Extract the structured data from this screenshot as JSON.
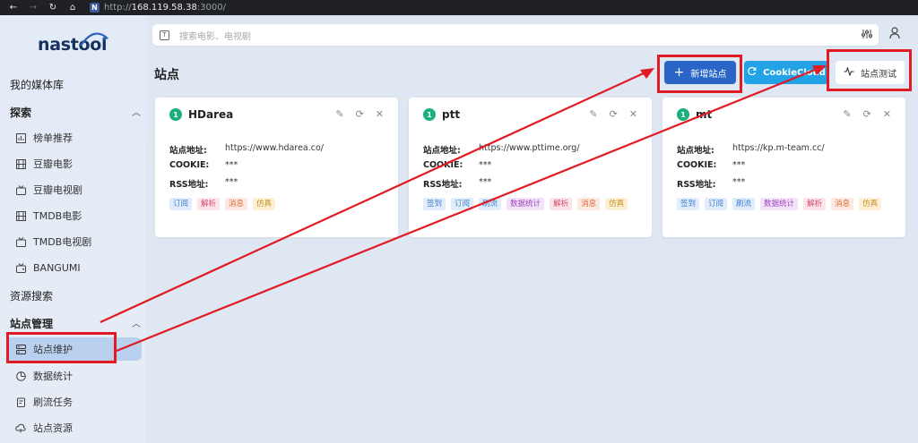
{
  "browser": {
    "url_scheme": "http://",
    "url_host": "168.119.58.38",
    "url_path": ":3000/"
  },
  "sidebar": {
    "logo_text": "nastool",
    "my_library": "我的媒体库",
    "explore_label": "探索",
    "explore_items": [
      "榜单推荐",
      "豆瓣电影",
      "豆瓣电视剧",
      "TMDB电影",
      "TMDB电视剧",
      "BANGUMI"
    ],
    "resource_search": "资源搜索",
    "site_mgmt_label": "站点管理",
    "site_items": [
      "站点维护",
      "数据统计",
      "刷流任务",
      "站点资源"
    ]
  },
  "search": {
    "placeholder": "搜索电影、电视剧"
  },
  "page": {
    "title": "站点",
    "add_site": "新增站点",
    "cookiecloud": "CookieCloud",
    "site_test": "站点测试"
  },
  "fields": {
    "address": "站点地址:",
    "cookie": "COOKIE:",
    "rss": "RSS地址:"
  },
  "sites": [
    {
      "num": "1",
      "name": "HDarea",
      "address": "https://www.hdarea.co/",
      "cookie": "***",
      "rss": "***",
      "tags": [
        {
          "text": "订阅",
          "color": "blue"
        },
        {
          "text": "解析",
          "color": "red"
        },
        {
          "text": "消息",
          "color": "orange"
        },
        {
          "text": "仿真",
          "color": "yellow"
        }
      ]
    },
    {
      "num": "1",
      "name": "ptt",
      "address": "https://www.pttime.org/",
      "cookie": "***",
      "rss": "***",
      "tags": [
        {
          "text": "签到",
          "color": "blue"
        },
        {
          "text": "订阅",
          "color": "blue"
        },
        {
          "text": "刷流",
          "color": "blue"
        },
        {
          "text": "数据统计",
          "color": "purple"
        },
        {
          "text": "解析",
          "color": "red"
        },
        {
          "text": "消息",
          "color": "orange"
        },
        {
          "text": "仿真",
          "color": "yellow"
        }
      ]
    },
    {
      "num": "1",
      "name": "mt",
      "address": "https://kp.m-team.cc/",
      "cookie": "***",
      "rss": "***",
      "tags": [
        {
          "text": "签到",
          "color": "blue"
        },
        {
          "text": "订阅",
          "color": "blue"
        },
        {
          "text": "刷流",
          "color": "blue"
        },
        {
          "text": "数据统计",
          "color": "purple"
        },
        {
          "text": "解析",
          "color": "red"
        },
        {
          "text": "消息",
          "color": "orange"
        },
        {
          "text": "仿真",
          "color": "yellow"
        }
      ]
    }
  ],
  "colors": {
    "accent": "#2a66c8",
    "cookiecloud": "#23a3e6",
    "annotation": "#e01b24",
    "site_badge": "#1bb07a"
  }
}
